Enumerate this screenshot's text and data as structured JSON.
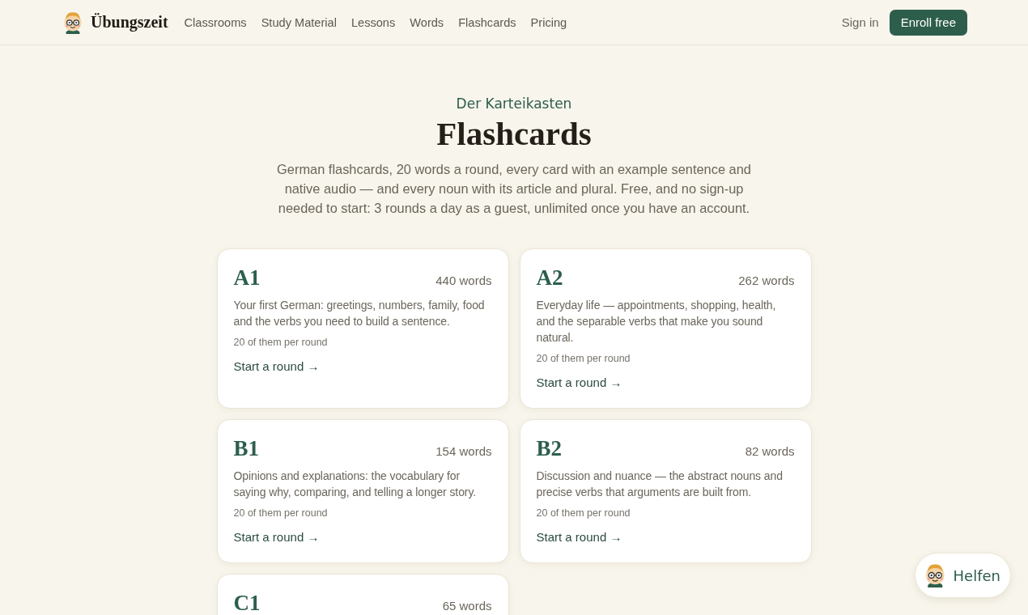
{
  "header": {
    "brand": "Übungszeit",
    "nav": [
      "Classrooms",
      "Study Material",
      "Lessons",
      "Words",
      "Flashcards",
      "Pricing"
    ],
    "sign_in": "Sign in",
    "cta": "Enroll free"
  },
  "hero": {
    "eyebrow": "Der Karteikasten",
    "title": "Flashcards",
    "intro": "German flashcards, 20 words a round, every card with an example sentence and native audio — and every noun with its article and plural. Free, and no sign-up needed to start: 3 rounds a day as a guest, unlimited once you have an account."
  },
  "levels": [
    {
      "level": "A1",
      "count": "440 words",
      "description": "Your first German: greetings, numbers, family, food and the verbs you need to build a sentence.",
      "per_round": "20 of them per round",
      "link": "Start a round →"
    },
    {
      "level": "A2",
      "count": "262 words",
      "description": "Everyday life — appointments, shopping, health, and the separable verbs that make you sound natural.",
      "per_round": "20 of them per round",
      "link": "Start a round →"
    },
    {
      "level": "B1",
      "count": "154 words",
      "description": "Opinions and explanations: the vocabulary for saying why, comparing, and telling a longer story.",
      "per_round": "20 of them per round",
      "link": "Start a round →"
    },
    {
      "level": "B2",
      "count": "82 words",
      "description": "Discussion and nuance — the abstract nouns and precise verbs that arguments are built from.",
      "per_round": "20 of them per round",
      "link": "Start a round →"
    },
    {
      "level": "C1",
      "count": "65 words"
    }
  ],
  "help_button": {
    "label": "Helfen"
  }
}
